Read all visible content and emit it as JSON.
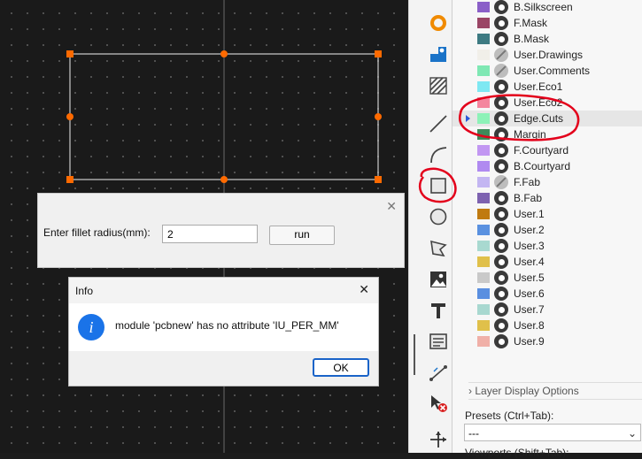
{
  "fillet_dialog": {
    "label": "Enter fillet radius(mm):",
    "value": "2",
    "run_label": "run",
    "close_glyph": "✕"
  },
  "info_dialog": {
    "title": "Info",
    "message": "module 'pcbnew' has no attribute 'IU_PER_MM'",
    "ok_label": "OK",
    "close_glyph": "✕",
    "icon_glyph": "i"
  },
  "layers": [
    {
      "name": "B.Silkscreen",
      "color": "#8a5fc8",
      "visible": true
    },
    {
      "name": "F.Mask",
      "color": "#9a4565",
      "visible": true
    },
    {
      "name": "B.Mask",
      "color": "#3d7a82",
      "visible": true
    },
    {
      "name": "User.Drawings",
      "color": "#f1efe9",
      "visible": false
    },
    {
      "name": "User.Comments",
      "color": "#7fe8b4",
      "visible": false
    },
    {
      "name": "User.Eco1",
      "color": "#7ee8f2",
      "visible": true
    },
    {
      "name": "User.Eco2",
      "color": "#f4869e",
      "visible": true
    },
    {
      "name": "Edge.Cuts",
      "color": "#8df2b8",
      "visible": true,
      "selected": true
    },
    {
      "name": "Margin",
      "color": "#3f8a5a",
      "visible": true
    },
    {
      "name": "F.Courtyard",
      "color": "#c297f2",
      "visible": true
    },
    {
      "name": "B.Courtyard",
      "color": "#b08af0",
      "visible": true
    },
    {
      "name": "F.Fab",
      "color": "#c3b6f2",
      "visible": false
    },
    {
      "name": "B.Fab",
      "color": "#7d62b0",
      "visible": true
    },
    {
      "name": "User.1",
      "color": "#c07a10",
      "visible": true
    },
    {
      "name": "User.2",
      "color": "#5a91e0",
      "visible": true
    },
    {
      "name": "User.3",
      "color": "#a8d9d0",
      "visible": true
    },
    {
      "name": "User.4",
      "color": "#e0c04a",
      "visible": true
    },
    {
      "name": "User.5",
      "color": "#c9c9c9",
      "visible": true
    },
    {
      "name": "User.6",
      "color": "#5a8fe0",
      "visible": true
    },
    {
      "name": "User.7",
      "color": "#a8d8d0",
      "visible": true
    },
    {
      "name": "User.8",
      "color": "#e0c04a",
      "visible": true
    },
    {
      "name": "User.9",
      "color": "#f0b0a8",
      "visible": true
    }
  ],
  "panel": {
    "layer_display_options": "Layer Display Options",
    "presets_label": "Presets (Ctrl+Tab):",
    "presets_value": "---",
    "viewports_label": "Viewports (Shift+Tab):"
  },
  "colors": {
    "annotation_red": "#e3001b",
    "selection_handle": "#ff6a00",
    "accent_blue": "#1a63c8"
  },
  "toolbar_icons": [
    "pad-icon",
    "footprint-icon",
    "zone-icon",
    "line-icon",
    "arc-icon",
    "rectangle-icon",
    "circle-icon",
    "polygon-icon",
    "image-icon",
    "text-icon",
    "textbox-icon",
    "dimension-icon",
    "delete-icon",
    "origin-icon"
  ]
}
